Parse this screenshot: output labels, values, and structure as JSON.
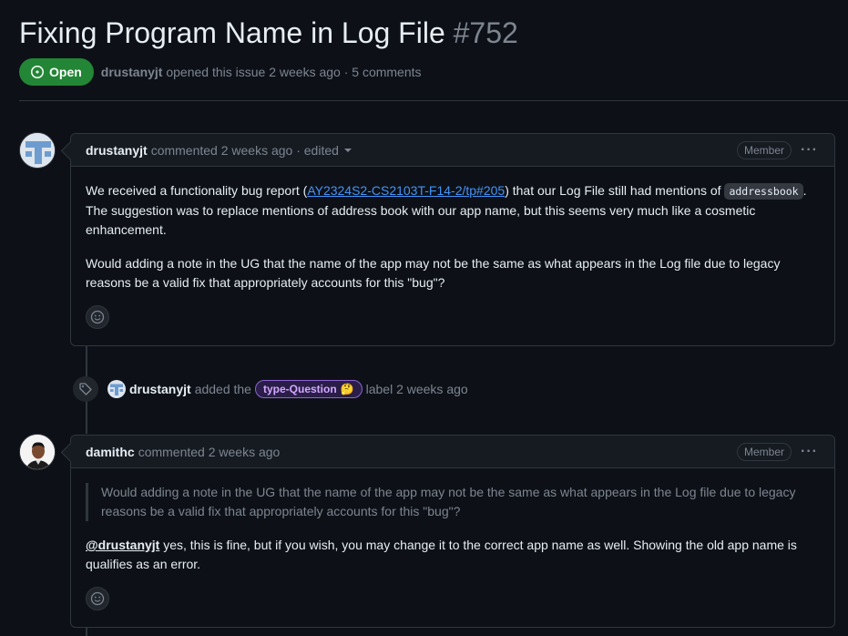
{
  "issue": {
    "title": "Fixing Program Name in Log File",
    "number": "#752",
    "state": "Open",
    "author": "drustanyjt",
    "meta": "opened this issue 2 weeks ago · 5 comments"
  },
  "comments": [
    {
      "author": "drustanyjt",
      "header_text": "commented 2 weeks ago · edited",
      "role": "Member",
      "menu": "···",
      "body": {
        "p1_before_link": "We received a functionality bug report (",
        "link_text": "AY2324S2-CS2103T-F14-2/tp#205",
        "p1_after_link": ") that our Log File still had mentions of ",
        "code": "addressbook",
        "p1_end": ". The suggestion was to replace mentions of address book with our app name, but this seems very much like a cosmetic enhancement.",
        "p2": "Would adding a note in the UG that the name of the app may not be the same as what appears in the Log file due to legacy reasons be a valid fix that appropriately accounts for this \"bug\"?"
      }
    },
    {
      "author": "damithc",
      "header_text": "commented 2 weeks ago",
      "role": "Member",
      "menu": "···",
      "body": {
        "quote": "Would adding a note in the UG that the name of the app may not be the same as what appears in the Log file due to legacy reasons be a valid fix that appropriately accounts for this \"bug\"?",
        "mention": "@drustanyjt",
        "reply": " yes, this is fine, but if you wish, you may change it to the correct app name as well. Showing the old app name is qualifies as an error."
      }
    }
  ],
  "event": {
    "author": "drustanyjt",
    "action": "added the",
    "label": "type-Question",
    "label_emoji": "🤔",
    "suffix": "label 2 weeks ago"
  },
  "icons": {
    "state": "issue-open-icon",
    "reaction": "smiley-icon",
    "event": "tag-icon"
  },
  "colors": {
    "open_green": "#238636",
    "link_blue": "#4493f8",
    "label_purple": "#d2a8ff"
  }
}
